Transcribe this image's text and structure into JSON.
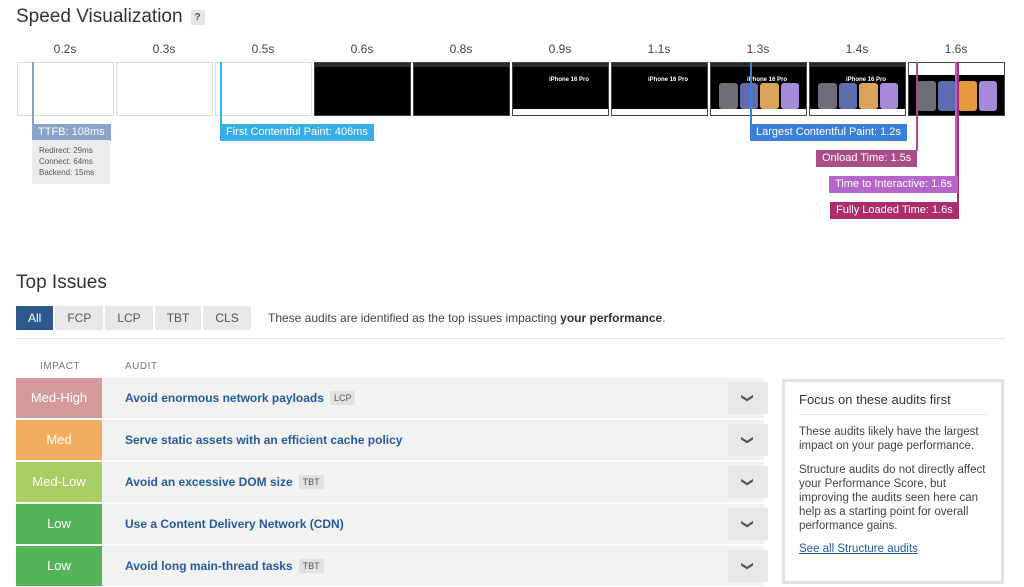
{
  "speed": {
    "title": "Speed Visualization",
    "help": "?",
    "times": [
      "0.2s",
      "0.3s",
      "0.5s",
      "0.6s",
      "0.8s",
      "0.9s",
      "1.1s",
      "1.3s",
      "1.4s",
      "1.6s"
    ],
    "frame_caption": "iPhone 16 Pro",
    "markers": {
      "ttfb": "TTFB: 108ms",
      "fcp": "First Contentful Paint: 406ms",
      "lcp": "Largest Contentful Paint: 1.2s",
      "onload": "Onload Time: 1.5s",
      "tti": "Time to Interactive: 1.6s",
      "fully": "Fully Loaded Time: 1.6s"
    },
    "ttfb_details": [
      "Redirect: 29ms",
      "Connect: 64ms",
      "Backend: 15ms"
    ],
    "colors": {
      "ttfb": "#8aa3c8",
      "fcp": "#39aee6",
      "lcp": "#3b7ed9",
      "onload": "#a94d86",
      "tti": "#b566c8",
      "fully": "#ad2d6a"
    }
  },
  "issues": {
    "title": "Top Issues",
    "tabs": [
      "All",
      "FCP",
      "LCP",
      "TBT",
      "CLS"
    ],
    "active_tab": "All",
    "desc_prefix": "These audits are identified as the top issues impacting ",
    "desc_bold": "your performance",
    "desc_suffix": ".",
    "col_impact": "IMPACT",
    "col_audit": "AUDIT",
    "rows": [
      {
        "impact": "Med-High",
        "color": "#d49a9a",
        "audit": "Avoid enormous network payloads",
        "tag": "LCP"
      },
      {
        "impact": "Med",
        "color": "#f2ad5e",
        "audit": "Serve static assets with an efficient cache policy",
        "tag": ""
      },
      {
        "impact": "Med-Low",
        "color": "#a7cf63",
        "audit": "Avoid an excessive DOM size",
        "tag": "TBT"
      },
      {
        "impact": "Low",
        "color": "#55b458",
        "audit": "Use a Content Delivery Network (CDN)",
        "tag": ""
      },
      {
        "impact": "Low",
        "color": "#55b458",
        "audit": "Avoid long main-thread tasks",
        "tag": "TBT"
      }
    ]
  },
  "focus": {
    "title": "Focus on these audits first",
    "p1": "These audits likely have the largest impact on your page performance.",
    "p2": "Structure audits do not directly affect your Performance Score, but improving the audits seen here can help as a starting point for overall performance gains.",
    "link": "See all Structure audits"
  }
}
